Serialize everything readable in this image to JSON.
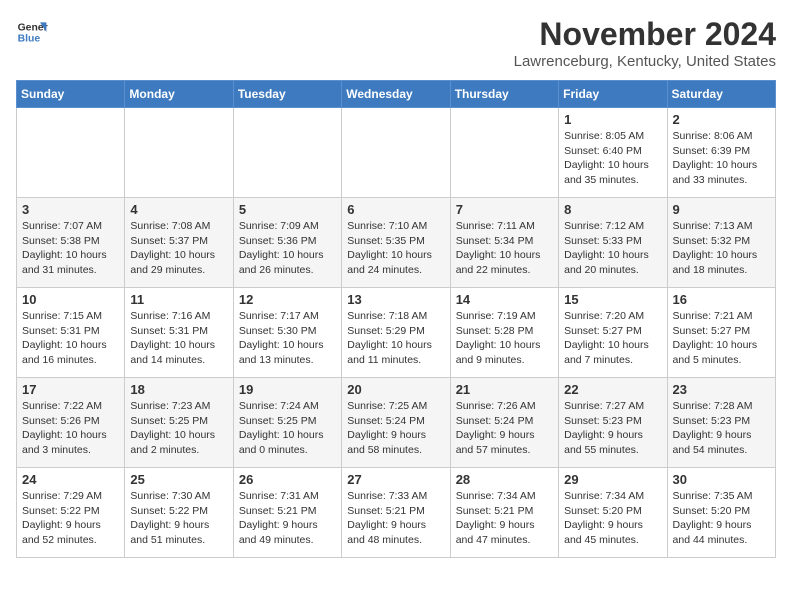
{
  "header": {
    "logo_line1": "General",
    "logo_line2": "Blue",
    "month_year": "November 2024",
    "location": "Lawrenceburg, Kentucky, United States"
  },
  "weekdays": [
    "Sunday",
    "Monday",
    "Tuesday",
    "Wednesday",
    "Thursday",
    "Friday",
    "Saturday"
  ],
  "weeks": [
    [
      {
        "day": "",
        "info": ""
      },
      {
        "day": "",
        "info": ""
      },
      {
        "day": "",
        "info": ""
      },
      {
        "day": "",
        "info": ""
      },
      {
        "day": "",
        "info": ""
      },
      {
        "day": "1",
        "info": "Sunrise: 8:05 AM\nSunset: 6:40 PM\nDaylight: 10 hours and 35 minutes."
      },
      {
        "day": "2",
        "info": "Sunrise: 8:06 AM\nSunset: 6:39 PM\nDaylight: 10 hours and 33 minutes."
      }
    ],
    [
      {
        "day": "3",
        "info": "Sunrise: 7:07 AM\nSunset: 5:38 PM\nDaylight: 10 hours and 31 minutes."
      },
      {
        "day": "4",
        "info": "Sunrise: 7:08 AM\nSunset: 5:37 PM\nDaylight: 10 hours and 29 minutes."
      },
      {
        "day": "5",
        "info": "Sunrise: 7:09 AM\nSunset: 5:36 PM\nDaylight: 10 hours and 26 minutes."
      },
      {
        "day": "6",
        "info": "Sunrise: 7:10 AM\nSunset: 5:35 PM\nDaylight: 10 hours and 24 minutes."
      },
      {
        "day": "7",
        "info": "Sunrise: 7:11 AM\nSunset: 5:34 PM\nDaylight: 10 hours and 22 minutes."
      },
      {
        "day": "8",
        "info": "Sunrise: 7:12 AM\nSunset: 5:33 PM\nDaylight: 10 hours and 20 minutes."
      },
      {
        "day": "9",
        "info": "Sunrise: 7:13 AM\nSunset: 5:32 PM\nDaylight: 10 hours and 18 minutes."
      }
    ],
    [
      {
        "day": "10",
        "info": "Sunrise: 7:15 AM\nSunset: 5:31 PM\nDaylight: 10 hours and 16 minutes."
      },
      {
        "day": "11",
        "info": "Sunrise: 7:16 AM\nSunset: 5:31 PM\nDaylight: 10 hours and 14 minutes."
      },
      {
        "day": "12",
        "info": "Sunrise: 7:17 AM\nSunset: 5:30 PM\nDaylight: 10 hours and 13 minutes."
      },
      {
        "day": "13",
        "info": "Sunrise: 7:18 AM\nSunset: 5:29 PM\nDaylight: 10 hours and 11 minutes."
      },
      {
        "day": "14",
        "info": "Sunrise: 7:19 AM\nSunset: 5:28 PM\nDaylight: 10 hours and 9 minutes."
      },
      {
        "day": "15",
        "info": "Sunrise: 7:20 AM\nSunset: 5:27 PM\nDaylight: 10 hours and 7 minutes."
      },
      {
        "day": "16",
        "info": "Sunrise: 7:21 AM\nSunset: 5:27 PM\nDaylight: 10 hours and 5 minutes."
      }
    ],
    [
      {
        "day": "17",
        "info": "Sunrise: 7:22 AM\nSunset: 5:26 PM\nDaylight: 10 hours and 3 minutes."
      },
      {
        "day": "18",
        "info": "Sunrise: 7:23 AM\nSunset: 5:25 PM\nDaylight: 10 hours and 2 minutes."
      },
      {
        "day": "19",
        "info": "Sunrise: 7:24 AM\nSunset: 5:25 PM\nDaylight: 10 hours and 0 minutes."
      },
      {
        "day": "20",
        "info": "Sunrise: 7:25 AM\nSunset: 5:24 PM\nDaylight: 9 hours and 58 minutes."
      },
      {
        "day": "21",
        "info": "Sunrise: 7:26 AM\nSunset: 5:24 PM\nDaylight: 9 hours and 57 minutes."
      },
      {
        "day": "22",
        "info": "Sunrise: 7:27 AM\nSunset: 5:23 PM\nDaylight: 9 hours and 55 minutes."
      },
      {
        "day": "23",
        "info": "Sunrise: 7:28 AM\nSunset: 5:23 PM\nDaylight: 9 hours and 54 minutes."
      }
    ],
    [
      {
        "day": "24",
        "info": "Sunrise: 7:29 AM\nSunset: 5:22 PM\nDaylight: 9 hours and 52 minutes."
      },
      {
        "day": "25",
        "info": "Sunrise: 7:30 AM\nSunset: 5:22 PM\nDaylight: 9 hours and 51 minutes."
      },
      {
        "day": "26",
        "info": "Sunrise: 7:31 AM\nSunset: 5:21 PM\nDaylight: 9 hours and 49 minutes."
      },
      {
        "day": "27",
        "info": "Sunrise: 7:33 AM\nSunset: 5:21 PM\nDaylight: 9 hours and 48 minutes."
      },
      {
        "day": "28",
        "info": "Sunrise: 7:34 AM\nSunset: 5:21 PM\nDaylight: 9 hours and 47 minutes."
      },
      {
        "day": "29",
        "info": "Sunrise: 7:34 AM\nSunset: 5:20 PM\nDaylight: 9 hours and 45 minutes."
      },
      {
        "day": "30",
        "info": "Sunrise: 7:35 AM\nSunset: 5:20 PM\nDaylight: 9 hours and 44 minutes."
      }
    ]
  ]
}
